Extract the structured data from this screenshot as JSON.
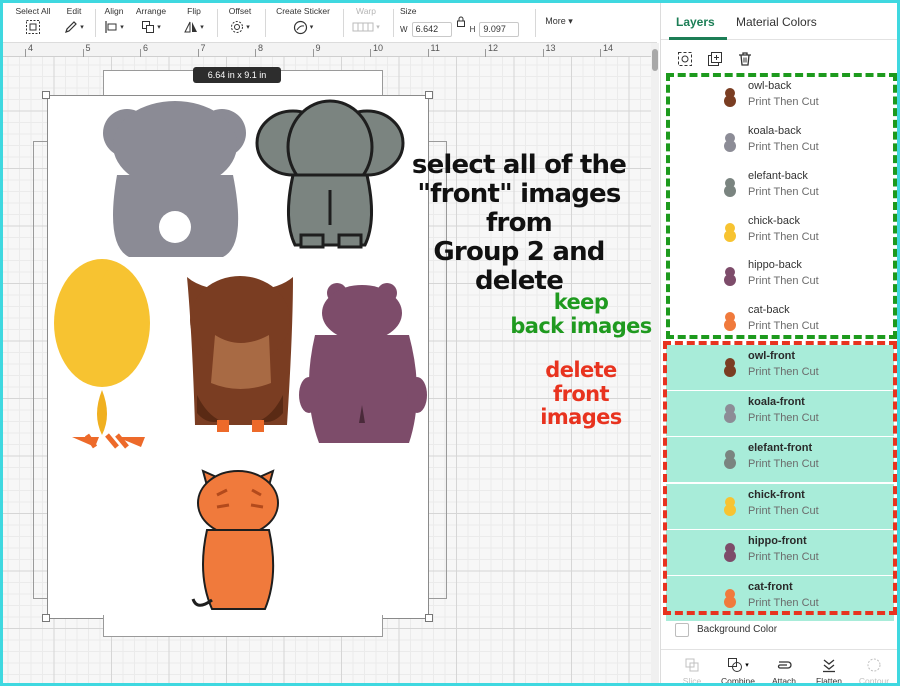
{
  "toolbar": {
    "select_all": "Select All",
    "edit": "Edit",
    "align": "Align",
    "arrange": "Arrange",
    "flip": "Flip",
    "offset": "Offset",
    "create_sticker": "Create Sticker",
    "warp": "Warp",
    "size": "Size",
    "w_label": "W",
    "w_value": "6.642",
    "h_label": "H",
    "h_value": "9.097",
    "more": "More"
  },
  "ruler": {
    "ticks": [
      "4",
      "5",
      "6",
      "7",
      "8",
      "9",
      "10",
      "11",
      "12",
      "13",
      "14"
    ]
  },
  "canvas": {
    "size_badge": "6.64  in x 9.1  in"
  },
  "annotations": {
    "main": [
      "select all of the",
      "\"front\" images from",
      "Group 2 and delete"
    ],
    "keep": [
      "keep",
      "back images"
    ],
    "delete": [
      "delete",
      "front images"
    ]
  },
  "panel": {
    "tab_layers": "Layers",
    "tab_material": "Material Colors",
    "layers": [
      {
        "name": "owl-back",
        "sub": "Print Then Cut",
        "selected": false,
        "color": "#7a3d22"
      },
      {
        "name": "koala-back",
        "sub": "Print Then Cut",
        "selected": false,
        "color": "#8c8c96"
      },
      {
        "name": "elefant-back",
        "sub": "Print Then Cut",
        "selected": false,
        "color": "#7a8480"
      },
      {
        "name": "chick-back",
        "sub": "Print Then Cut",
        "selected": false,
        "color": "#f7c331"
      },
      {
        "name": "hippo-back",
        "sub": "Print Then Cut",
        "selected": false,
        "color": "#7d4c6a"
      },
      {
        "name": "cat-back",
        "sub": "Print Then Cut",
        "selected": false,
        "color": "#f07a3c"
      },
      {
        "name": "owl-front",
        "sub": "Print Then Cut",
        "selected": true,
        "color": "#7a3d22"
      },
      {
        "name": "koala-front",
        "sub": "Print Then Cut",
        "selected": true,
        "color": "#8c8c96"
      },
      {
        "name": "elefant-front",
        "sub": "Print Then Cut",
        "selected": true,
        "color": "#7a8480"
      },
      {
        "name": "chick-front",
        "sub": "Print Then Cut",
        "selected": true,
        "color": "#f7c331"
      },
      {
        "name": "hippo-front",
        "sub": "Print Then Cut",
        "selected": true,
        "color": "#7d4c6a"
      },
      {
        "name": "cat-front",
        "sub": "Print Then Cut",
        "selected": true,
        "color": "#f07a3c"
      }
    ],
    "background_color": "Background Color",
    "bottom": {
      "slice": "Slice",
      "combine": "Combine",
      "attach": "Attach",
      "flatten": "Flatten",
      "contour": "Contour"
    }
  },
  "colors": {
    "accent": "#1c7e56",
    "selected_row": "#a8ecd9",
    "keep_green": "#1d9a1d",
    "delete_red": "#e8331f",
    "frame_cyan": "#3fd8e0"
  }
}
